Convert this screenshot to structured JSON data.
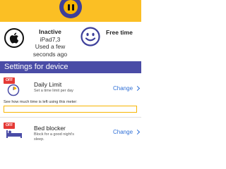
{
  "device": {
    "status": "Inactive",
    "name": "iPad7,3",
    "last_used": "Used a few seconds ago",
    "platform_icon": "apple-icon",
    "mode_label": "Free time",
    "mode_icon": "smiley-icon"
  },
  "section_title": "Settings for device",
  "daily_limit": {
    "badge": "OFF",
    "title": "Daily Limit",
    "subtitle": "Set a time limit per day",
    "change_label": "Change",
    "meter_label": "See how much time is left using this meter:",
    "meter_fraction": 0.0
  },
  "bed_blocker": {
    "badge": "OFF",
    "title": "Bed blocker",
    "subtitle": "Block for a good night's sleep.",
    "change_label": "Change"
  },
  "colors": {
    "accent_yellow": "#f7b500",
    "header_purple": "#4a4ca6",
    "link_blue": "#2f6fd6",
    "off_red": "#e53935"
  }
}
